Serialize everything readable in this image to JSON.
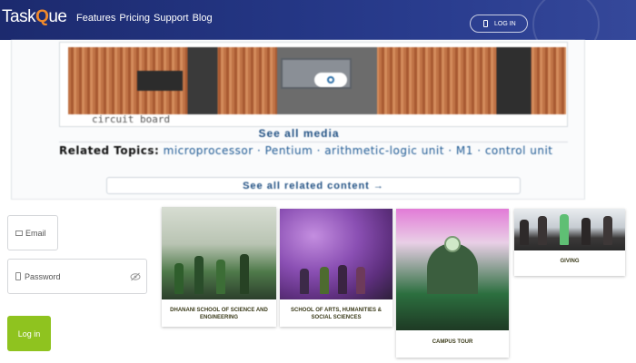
{
  "navbar": {
    "logo": {
      "part1": "Task",
      "part2": "Q",
      "part3": "ue"
    },
    "links": [
      "Features",
      "Pricing",
      "Support",
      "Blog"
    ],
    "login_label": "LOG IN"
  },
  "article": {
    "caption": "circuit board",
    "see_media": "See all media",
    "related_label": "Related Topics:",
    "related_items": "microprocessor · Pentium · arithmetic-logic unit · M1 · control unit",
    "see_related": "See all related content →"
  },
  "form": {
    "email_placeholder": "Email",
    "password_placeholder": "Password",
    "login_label": "Log in"
  },
  "cards": [
    {
      "label": "DHANANI SCHOOL OF SCIENCE AND ENGINEERING"
    },
    {
      "label": "SCHOOL OF ARTS, HUMANITIES & SOCIAL SCIENCES"
    },
    {
      "label": "CAMPUS TOUR"
    },
    {
      "label": "GIVING"
    }
  ],
  "colors": {
    "navbar": "#243684",
    "logo_accent": "#f08a2c",
    "login_button": "#8fc31f",
    "link": "#1f4f82"
  }
}
